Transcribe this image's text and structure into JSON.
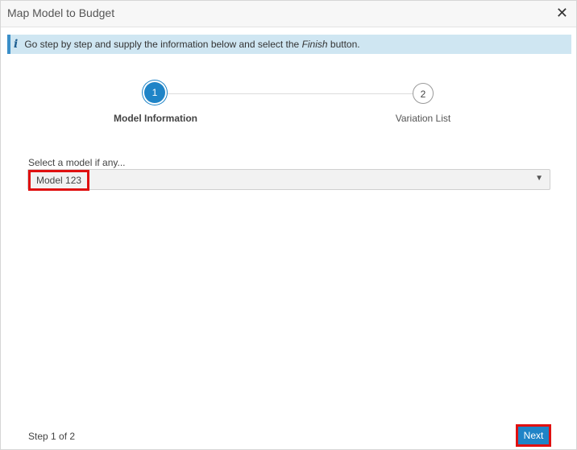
{
  "dialog": {
    "title": "Map Model to Budget",
    "close_label": "✕"
  },
  "info": {
    "icon": "info-icon",
    "text_before": "Go step by step and supply the information below and select the ",
    "text_emphasis": "Finish",
    "text_after": " button."
  },
  "stepper": {
    "steps": [
      {
        "number": "1",
        "label": "Model Information",
        "active": true
      },
      {
        "number": "2",
        "label": "Variation List",
        "active": false
      }
    ]
  },
  "model_select": {
    "label": "Select a model if any...",
    "selected_value": "Model 123",
    "arrow": "▼"
  },
  "footer": {
    "step_counter": "Step 1 of 2",
    "next_label": "Next"
  },
  "colors": {
    "accent": "#1f84c7",
    "highlight": "#e01010",
    "info_bg": "#cfe6f2"
  }
}
